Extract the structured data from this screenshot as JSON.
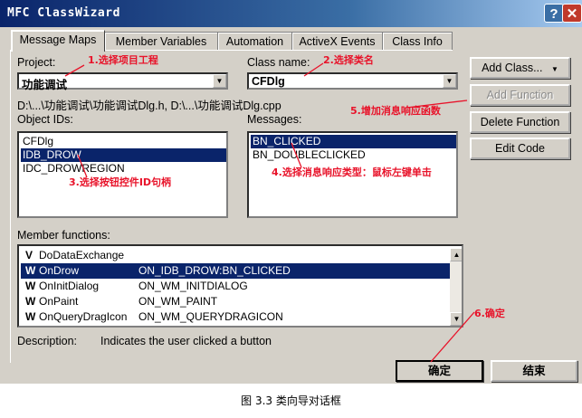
{
  "window": {
    "title": "MFC ClassWizard",
    "help": "?",
    "close": "✕"
  },
  "tabs": [
    "Message Maps",
    "Member Variables",
    "Automation",
    "ActiveX Events",
    "Class Info"
  ],
  "project": {
    "label": "Project:",
    "value": "功能调试",
    "annotation": "1.选择项目工程"
  },
  "class_name": {
    "label": "Class name:",
    "value": "CFDlg",
    "annotation": "2.选择类名"
  },
  "file_path": "D:\\...\\功能调试\\功能调试Dlg.h, D:\\...\\功能调试Dlg.cpp",
  "object_ids": {
    "label": "Object IDs:",
    "items": [
      "CFDlg",
      "IDB_DROW",
      "IDC_DROWREGION"
    ],
    "selected": 1,
    "annotation": "3.选择按钮控件ID句柄"
  },
  "messages": {
    "label": "Messages:",
    "items": [
      "BN_CLICKED",
      "BN_DOUBLECLICKED"
    ],
    "selected": 0,
    "annotation": "4.选择消息响应类型：鼠标左键单击"
  },
  "member_functions": {
    "label": "Member functions:",
    "rows": [
      {
        "kind": "V",
        "name": "DoDataExchange",
        "handler": ""
      },
      {
        "kind": "W",
        "name": "OnDrow",
        "handler": "ON_IDB_DROW:BN_CLICKED"
      },
      {
        "kind": "W",
        "name": "OnInitDialog",
        "handler": "ON_WM_INITDIALOG"
      },
      {
        "kind": "W",
        "name": "OnPaint",
        "handler": "ON_WM_PAINT"
      },
      {
        "kind": "W",
        "name": "OnQueryDragIcon",
        "handler": "ON_WM_QUERYDRAGICON"
      }
    ],
    "selected": 1
  },
  "description": {
    "label": "Description:",
    "text": "Indicates the user clicked a button"
  },
  "buttons": {
    "add_class": "Add Class...",
    "add_function": "Add Function",
    "delete_function": "Delete Function",
    "edit_code": "Edit Code",
    "ok": "确定",
    "cancel": "结束"
  },
  "annotations": {
    "add_function": "5.增加消息响应函数",
    "ok": "6.确定"
  },
  "caption": "图 3.3 类向导对话框",
  "colors": {
    "selection": "#0a246a",
    "annotation": "#e8132a",
    "face": "#d4d0c8"
  }
}
